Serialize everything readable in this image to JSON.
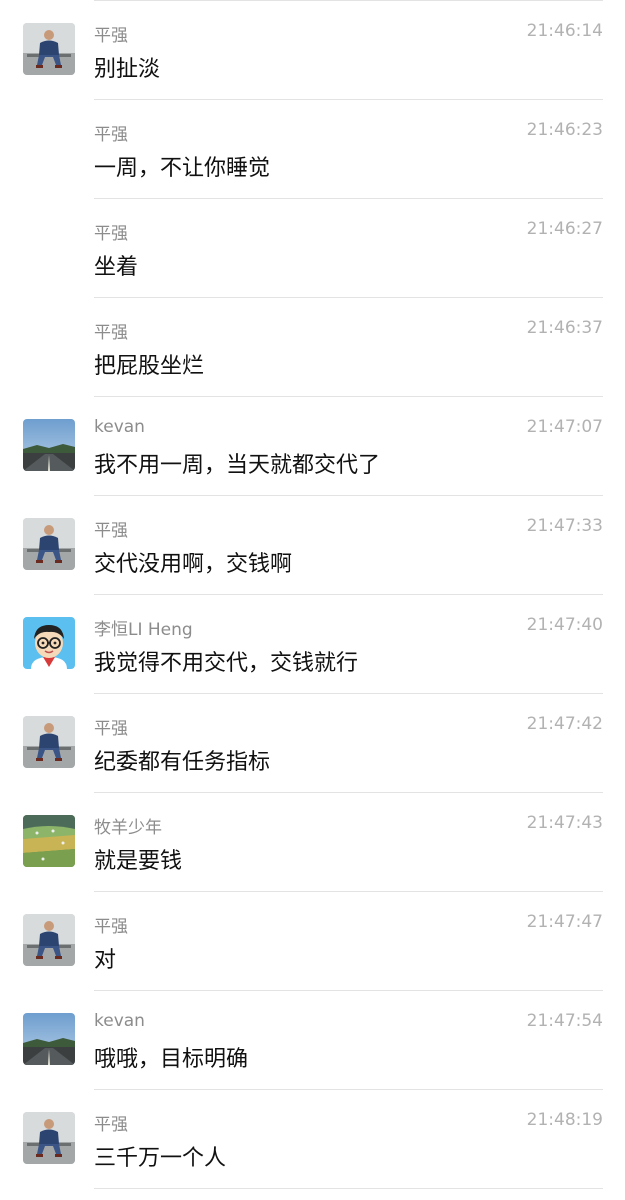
{
  "messages": [
    {
      "sender": "平强",
      "time": "21:46:14",
      "text": "别扯淡",
      "avatar": "ping-avatar"
    },
    {
      "sender": "平强",
      "time": "21:46:23",
      "text": "一周，不让你睡觉",
      "avatar": ""
    },
    {
      "sender": "平强",
      "time": "21:46:27",
      "text": "坐着",
      "avatar": ""
    },
    {
      "sender": "平强",
      "time": "21:46:37",
      "text": "把屁股坐烂",
      "avatar": ""
    },
    {
      "sender": "kevan",
      "time": "21:47:07",
      "text": "我不用一周，当天就都交代了",
      "avatar": "kevan-avatar"
    },
    {
      "sender": "平强",
      "time": "21:47:33",
      "text": "交代没用啊，交钱啊",
      "avatar": "ping-avatar"
    },
    {
      "sender": "李恒LI Heng",
      "time": "21:47:40",
      "text": "我觉得不用交代，交钱就行",
      "avatar": "liheng-avatar"
    },
    {
      "sender": "平强",
      "time": "21:47:42",
      "text": "纪委都有任务指标",
      "avatar": "ping-avatar"
    },
    {
      "sender": "牧羊少年",
      "time": "21:47:43",
      "text": "就是要钱",
      "avatar": "muyang-avatar"
    },
    {
      "sender": "平强",
      "time": "21:47:47",
      "text": "对",
      "avatar": "ping-avatar"
    },
    {
      "sender": "kevan",
      "time": "21:47:54",
      "text": "哦哦，目标明确",
      "avatar": "kevan-avatar"
    },
    {
      "sender": "平强",
      "time": "21:48:19",
      "text": "三千万一个人",
      "avatar": "ping-avatar"
    }
  ]
}
